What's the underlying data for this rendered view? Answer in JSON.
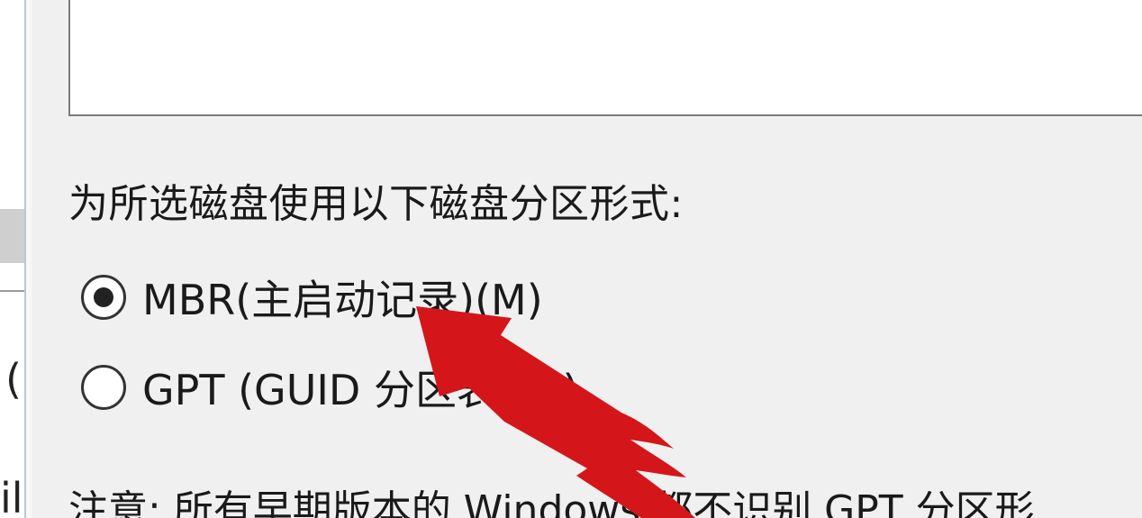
{
  "background_window": {
    "ghost_char_1": "(",
    "ghost_char_2": "il"
  },
  "dialog": {
    "prompt": "为所选磁盘使用以下磁盘分区形式:",
    "options": [
      {
        "label": "MBR(主启动记录)(M)",
        "selected": true
      },
      {
        "label": "GPT (GUID 分区表)(G)",
        "selected": false
      }
    ],
    "note": "注意: 所有早期版本的 Windows 都不识别 GPT 分区形"
  },
  "annotation": {
    "arrow_color": "#d4161b"
  }
}
